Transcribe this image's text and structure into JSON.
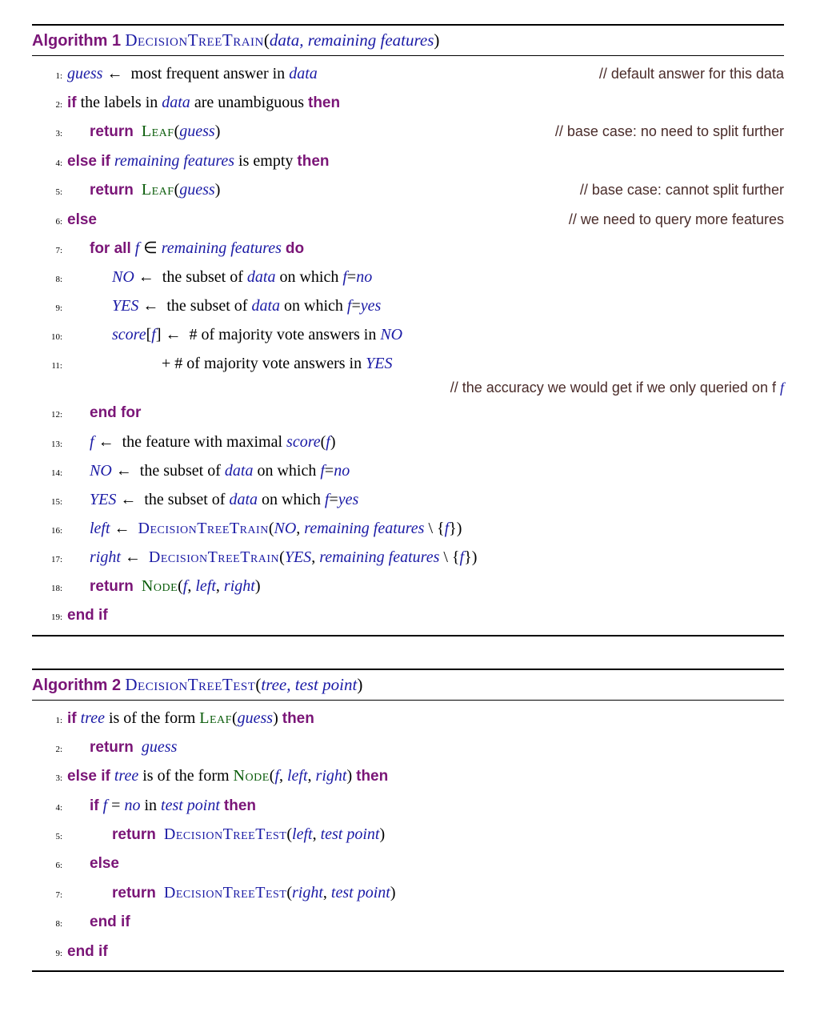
{
  "algo1": {
    "label": "Algorithm 1",
    "fn": "DecisionTreeTrain",
    "args": "data, remaining features",
    "lines": {
      "1": {
        "n": "1:",
        "c": "// default answer for this data"
      },
      "2": {
        "n": "2:"
      },
      "3": {
        "n": "3:",
        "c": "// base case: no need to split further"
      },
      "4": {
        "n": "4:"
      },
      "5": {
        "n": "5:",
        "c": "// base case: cannot split further"
      },
      "6": {
        "n": "6:",
        "c": "// we need to query more features"
      },
      "7": {
        "n": "7:"
      },
      "8": {
        "n": "8:"
      },
      "9": {
        "n": "9:"
      },
      "10": {
        "n": "10:"
      },
      "11": {
        "n": "11:"
      },
      "11c": {
        "c": "// the accuracy we would get if we only queried on f"
      },
      "12": {
        "n": "12:"
      },
      "13": {
        "n": "13:"
      },
      "14": {
        "n": "14:"
      },
      "15": {
        "n": "15:"
      },
      "16": {
        "n": "16:"
      },
      "17": {
        "n": "17:"
      },
      "18": {
        "n": "18:"
      },
      "19": {
        "n": "19:"
      }
    },
    "txt": {
      "guess": "guess",
      "arrow": " ←  ",
      "l1b": "most frequent answer in ",
      "data": "data",
      "if": "if",
      "then": "then",
      "elseif": "else if",
      "else": "else",
      "endif": "end if",
      "forall": "for all",
      "do": "do",
      "endfor": "end for",
      "return": "return",
      "l2": " the labels in ",
      "l2b": " are unambiguous ",
      "leaf": "Leaf",
      "node": "Node",
      "l4a": "remaining features",
      "l4b": " is empty ",
      "in": " ∈ ",
      "f": "f",
      "no": "no",
      "yes": "yes",
      "NO": "NO",
      "YES": "YES",
      "l8": " ←  the subset of ",
      "l8b": " on which ",
      "eq": "=",
      "score": "score",
      "l10": " ←  # of majority vote answers in ",
      "l11": "+ # of majority vote answers in ",
      "l13": " ←  the feature with maximal ",
      "left": "left",
      "right": "right",
      "dtt": "DecisionTreeTrain",
      "setminus": " \\ {",
      "rbrace": "}"
    }
  },
  "algo2": {
    "label": "Algorithm 2",
    "fn": "DecisionTreeTest",
    "args": "tree, test point",
    "lines": {
      "1": {
        "n": "1:"
      },
      "2": {
        "n": "2:"
      },
      "3": {
        "n": "3:"
      },
      "4": {
        "n": "4:"
      },
      "5": {
        "n": "5:"
      },
      "6": {
        "n": "6:"
      },
      "7": {
        "n": "7:"
      },
      "8": {
        "n": "8:"
      },
      "9": {
        "n": "9:"
      }
    },
    "txt": {
      "tree": "tree",
      "form": " is of the form ",
      "guess": "guess",
      "f": "f",
      "left": "left",
      "right": "right",
      "testpoint": "test point",
      "ifno": " = ",
      "no": "no",
      "in": " in ",
      "dttest": "DecisionTreeTest"
    }
  }
}
